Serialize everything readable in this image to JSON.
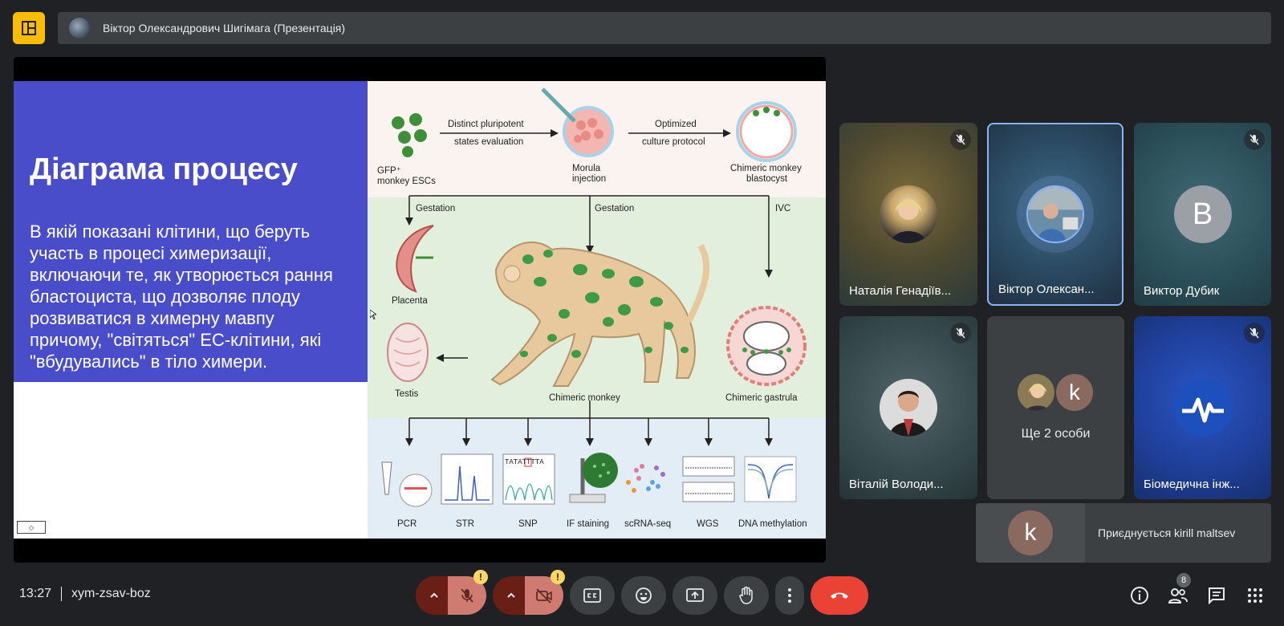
{
  "header": {
    "presenter_title": "Віктор Олександрович Шигімага (Презентація)"
  },
  "slide": {
    "title": "Діаграма процесу",
    "body": "В якій показані клітини, що беруть участь в процесі химеризації, включаючи те, як утворюється рання бластоциста, що дозволяє плоду розвиватися в химерну мавпу причому, \"світяться\" ЕС-клітини, які \"вбудувались\" в тіло химери.",
    "diagram": {
      "gfp": "GFP⁺",
      "monkey_escs": "monkey ESCs",
      "distinct_1": "Distinct pluripotent",
      "distinct_2": "states evaluation",
      "morula_1": "Morula",
      "morula_2": "injection",
      "optimized_1": "Optimized",
      "optimized_2": "culture protocol",
      "chimeric_blast_1": "Chimeric monkey",
      "chimeric_blast_2": "blastocyst",
      "gestation_left": "Gestation",
      "gestation_mid": "Gestation",
      "ivc": "IVC",
      "placenta": "Placenta",
      "testis": "Testis",
      "chimeric_monkey": "Chimeric monkey",
      "chimeric_gastrula": "Chimeric gastrula",
      "dna_seq": "TATATTTTA",
      "assays": [
        "PCR",
        "STR",
        "SNP",
        "IF staining",
        "scRNA-seq",
        "WGS",
        "DNA methylation"
      ]
    }
  },
  "participants": [
    {
      "name": "Наталія Генадіїв...",
      "muted": true
    },
    {
      "name": "Віктор Олексан...",
      "muted": false,
      "active": true
    },
    {
      "name": "Виктор Дубик",
      "muted": true,
      "initial": "В"
    },
    {
      "name": "Віталій Володи...",
      "muted": true
    },
    {
      "name": "Ще 2 особи",
      "initial": "k"
    },
    {
      "name": "Біомедична інж...",
      "muted": true
    }
  ],
  "joining": {
    "initial": "k",
    "text": "Приєднується kirill maltsev"
  },
  "bottom": {
    "time": "13:27",
    "meeting_code": "xym-zsav-boz",
    "warn_mark": "!",
    "people_count": "8"
  },
  "colors": {
    "accent_yellow": "#fbbc04",
    "end_call_red": "#ea4335",
    "slide_blue": "#4a4dc9",
    "active_border": "#8ab4f8",
    "muted_bg": "#d07b72"
  }
}
